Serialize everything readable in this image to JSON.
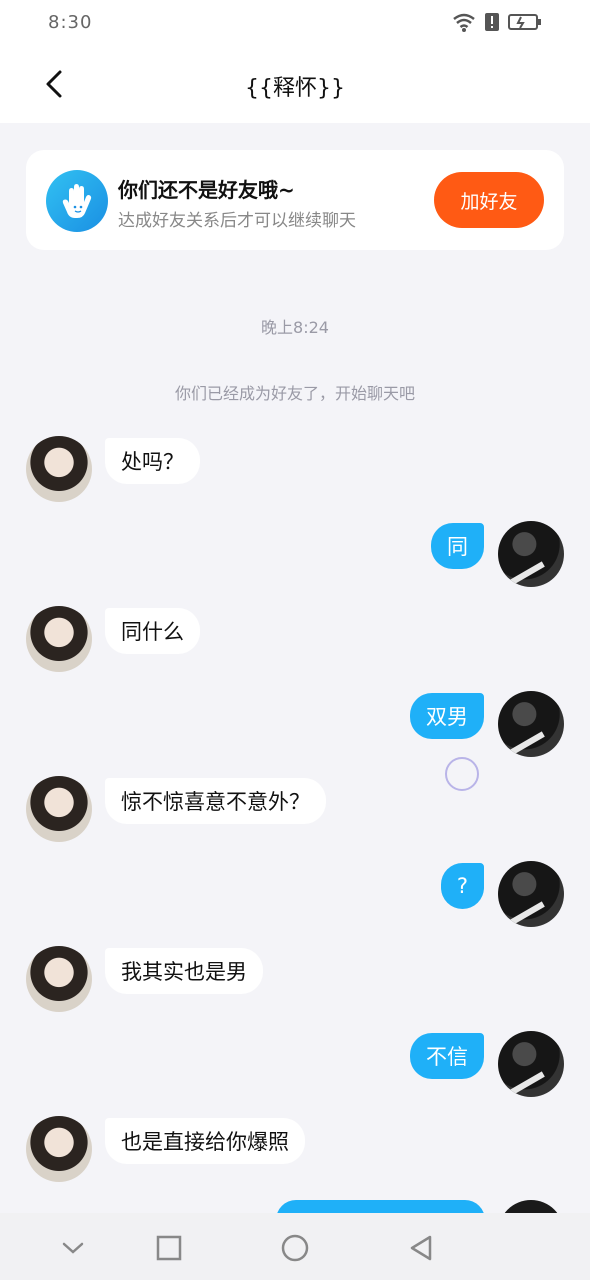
{
  "status_bar": {
    "time": "8:30"
  },
  "header": {
    "title": "{{释怀}}"
  },
  "friend_card": {
    "title": "你们还不是好友哦~",
    "subtitle": "达成好友关系后才可以继续聊天",
    "add_button": "加好友"
  },
  "chat": {
    "time_label": "晚上8:24",
    "system_notice": "你们已经成为好友了，开始聊天吧",
    "messages": [
      {
        "side": "left",
        "text": "处吗？"
      },
      {
        "side": "right",
        "text": "同"
      },
      {
        "side": "left",
        "text": "同什么"
      },
      {
        "side": "right",
        "text": "双男"
      },
      {
        "side": "left",
        "text": "惊不惊喜意不意外？"
      },
      {
        "side": "right",
        "text": "?"
      },
      {
        "side": "left",
        "text": "我其实也是男"
      },
      {
        "side": "right",
        "text": "不信"
      },
      {
        "side": "left",
        "text": "也是直接给你爆照"
      }
    ]
  },
  "icons": {
    "back": "back-arrow-icon",
    "add_friend_hand": "waving-hand-icon",
    "wifi": "wifi-icon",
    "alert": "alert-icon",
    "battery": "battery-charging-icon",
    "nav_down": "chevron-down-icon",
    "nav_recent": "square-icon",
    "nav_home": "circle-icon",
    "nav_back": "triangle-back-icon"
  },
  "colors": {
    "accent_blue": "#1fb0f8",
    "add_button": "#ff5a14",
    "background": "#f4f4f8"
  }
}
